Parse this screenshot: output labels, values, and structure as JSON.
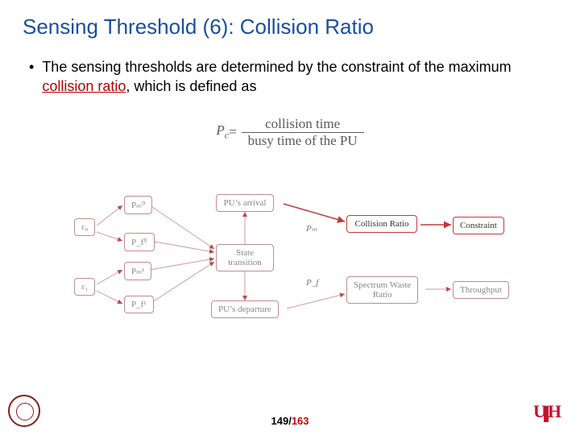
{
  "title": "Sensing Threshold (6): Collision Ratio",
  "bullet": {
    "prefix": "The sensing thresholds are determined by the constraint of the maximum ",
    "term": "collision ratio",
    "suffix": ", which is defined as"
  },
  "equation": {
    "lhs_main": "P",
    "lhs_sub": "c",
    "eq": " = ",
    "numerator": "collision time",
    "denominator": "busy time of the PU"
  },
  "diagram": {
    "n_eps0": "ε₀",
    "n_eps1": "ε₁",
    "n_Pm0": "Pₘ⁰",
    "n_Pf0": "P_f⁰",
    "n_Pm1": "Pₘ¹",
    "n_Pf1": "P_f¹",
    "n_arrival": "PU’s arrival",
    "n_state": "State\ntransition",
    "n_departure": "PU’s departure",
    "n_collision": "Collision Ratio",
    "n_constraint": "Constraint",
    "n_swr": "Spectrum Waste\nRatio",
    "n_throughput": "Throughput",
    "e_Pm": "Pₘ",
    "e_Pf": "P_f"
  },
  "page": {
    "current": "149",
    "total": "163"
  }
}
